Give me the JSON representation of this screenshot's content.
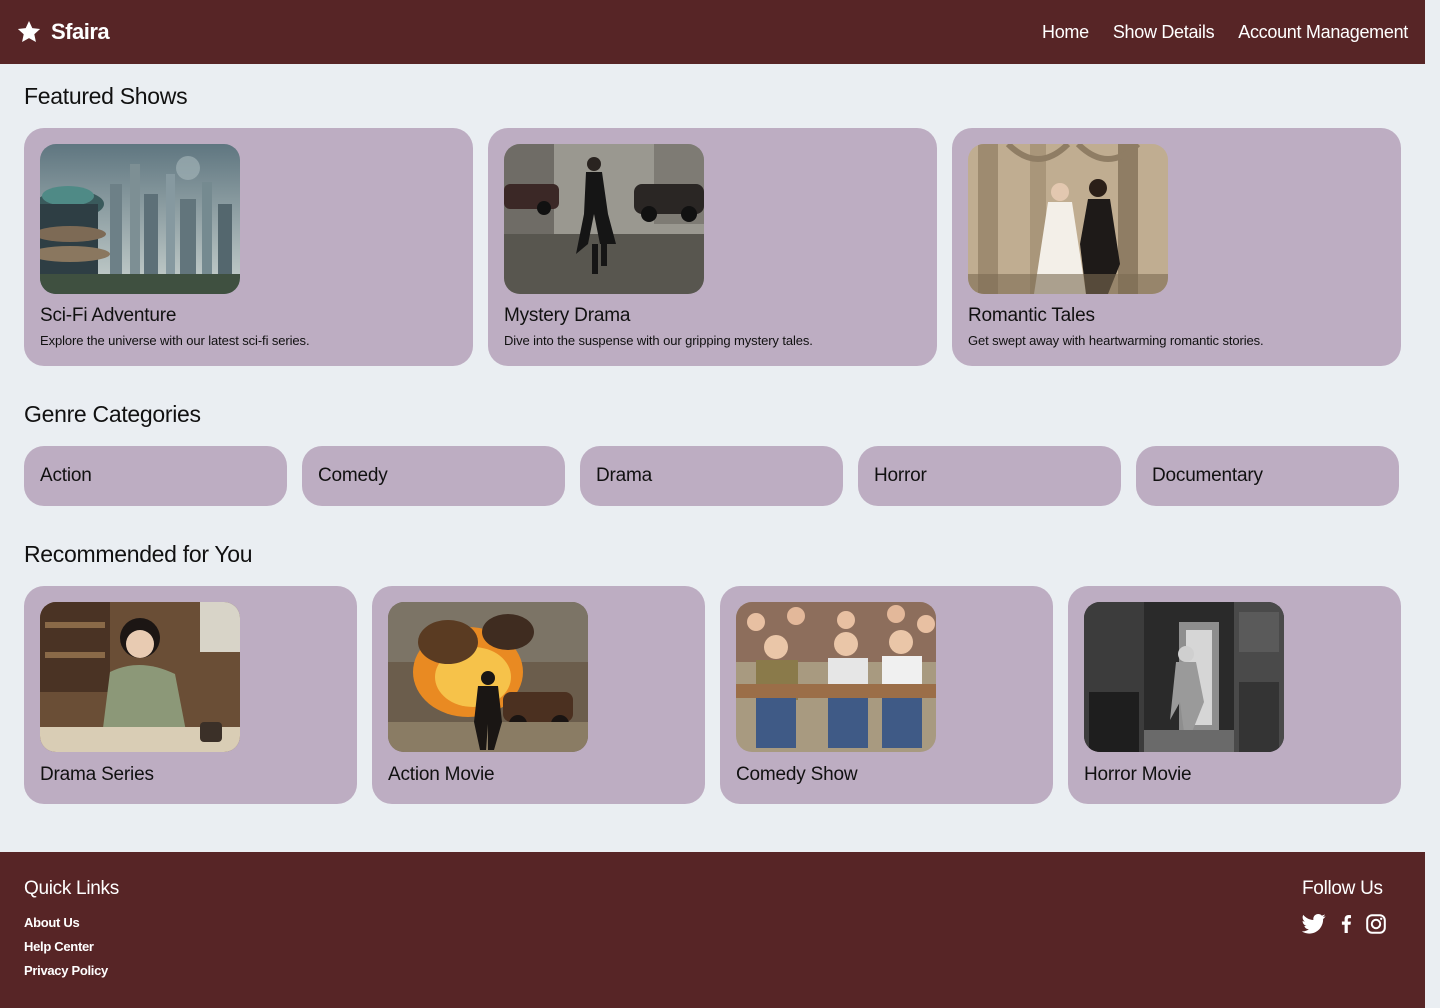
{
  "brand": {
    "name": "Sfaira",
    "icon": "star-icon"
  },
  "nav": {
    "items": [
      {
        "label": "Home"
      },
      {
        "label": "Show Details"
      },
      {
        "label": "Account Management"
      }
    ]
  },
  "featured": {
    "title": "Featured Shows",
    "cards": [
      {
        "title": "Sci-Fi Adventure",
        "description": "Explore the universe with our latest sci-fi series.",
        "image": "futuristic-city-image"
      },
      {
        "title": "Mystery Drama",
        "description": "Dive into the suspense with our gripping mystery tales.",
        "image": "man-walking-street-image"
      },
      {
        "title": "Romantic Tales",
        "description": "Get swept away with heartwarming romantic stories.",
        "image": "wedding-couple-image"
      }
    ]
  },
  "genres": {
    "title": "Genre Categories",
    "items": [
      {
        "label": "Action"
      },
      {
        "label": "Comedy"
      },
      {
        "label": "Drama"
      },
      {
        "label": "Horror"
      },
      {
        "label": "Documentary"
      }
    ]
  },
  "recommended": {
    "title": "Recommended for You",
    "cards": [
      {
        "title": "Drama Series",
        "image": "girl-writing-image"
      },
      {
        "title": "Action Movie",
        "image": "burning-car-image"
      },
      {
        "title": "Comedy Show",
        "image": "cartoon-crowd-image"
      },
      {
        "title": "Horror Movie",
        "image": "dark-hallway-image"
      }
    ]
  },
  "footer": {
    "quick_links": {
      "title": "Quick Links",
      "links": [
        {
          "label": "About Us"
        },
        {
          "label": "Help Center"
        },
        {
          "label": "Privacy Policy"
        }
      ]
    },
    "follow": {
      "title": "Follow Us",
      "icons": [
        "twitter-icon",
        "facebook-icon",
        "instagram-icon"
      ]
    }
  },
  "colors": {
    "header_bg": "#572526",
    "page_bg": "#eaeef2",
    "card_bg": "#bdadc2",
    "text": "#111111"
  }
}
